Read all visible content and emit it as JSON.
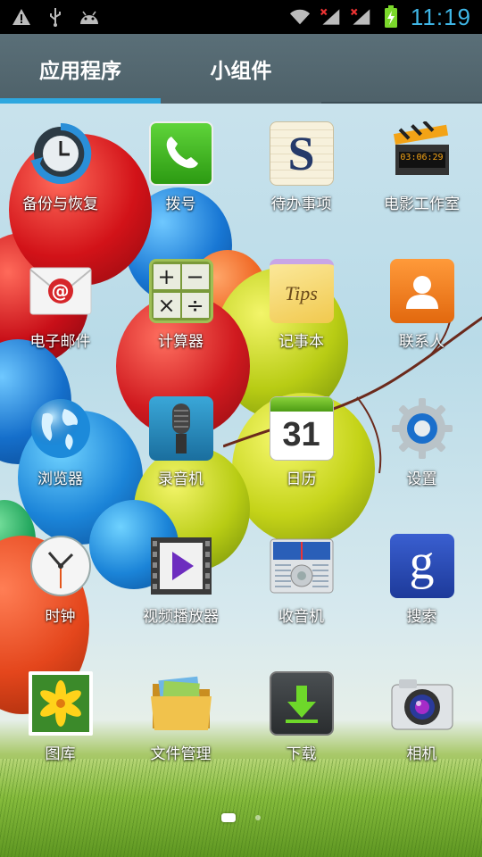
{
  "status_bar": {
    "time": "11:19",
    "left_icons": [
      "warning-icon",
      "usb-icon",
      "android-debug-icon"
    ],
    "right_icons": [
      "wifi-icon",
      "signal-1-icon",
      "signal-2-icon",
      "battery-charging-icon"
    ]
  },
  "tabs": [
    {
      "label": "应用程序",
      "active": true
    },
    {
      "label": "小组件",
      "active": false
    }
  ],
  "apps": [
    {
      "label": "备份与恢复",
      "icon": "backup-restore-icon"
    },
    {
      "label": "拨号",
      "icon": "phone-icon"
    },
    {
      "label": "待办事项",
      "icon": "todo-icon"
    },
    {
      "label": "电影工作室",
      "icon": "movie-studio-icon"
    },
    {
      "label": "电子邮件",
      "icon": "email-icon"
    },
    {
      "label": "计算器",
      "icon": "calculator-icon"
    },
    {
      "label": "记事本",
      "icon": "notepad-icon"
    },
    {
      "label": "联系人",
      "icon": "contacts-icon"
    },
    {
      "label": "浏览器",
      "icon": "browser-icon"
    },
    {
      "label": "录音机",
      "icon": "recorder-icon"
    },
    {
      "label": "日历",
      "icon": "calendar-icon"
    },
    {
      "label": "设置",
      "icon": "settings-icon"
    },
    {
      "label": "时钟",
      "icon": "clock-icon"
    },
    {
      "label": "视频播放器",
      "icon": "video-player-icon"
    },
    {
      "label": "收音机",
      "icon": "radio-icon"
    },
    {
      "label": "搜索",
      "icon": "search-icon"
    },
    {
      "label": "图库",
      "icon": "gallery-icon"
    },
    {
      "label": "文件管理",
      "icon": "file-manager-icon"
    },
    {
      "label": "下载",
      "icon": "download-icon"
    },
    {
      "label": "相机",
      "icon": "camera-icon"
    }
  ],
  "icon_text": {
    "todo_letter": "S",
    "movie_timecode": "03:06:29",
    "email_symbol": "@",
    "calc_symbols": [
      "+",
      "−",
      "×",
      "÷"
    ],
    "notepad_word": "Tips",
    "calendar_day": "31",
    "search_letter": "g"
  },
  "page_indicator": {
    "pages": 2,
    "current": 1
  },
  "colors": {
    "accent": "#2ea7df",
    "clock": "#3fb6e6",
    "tab_bar": "#56697a"
  }
}
